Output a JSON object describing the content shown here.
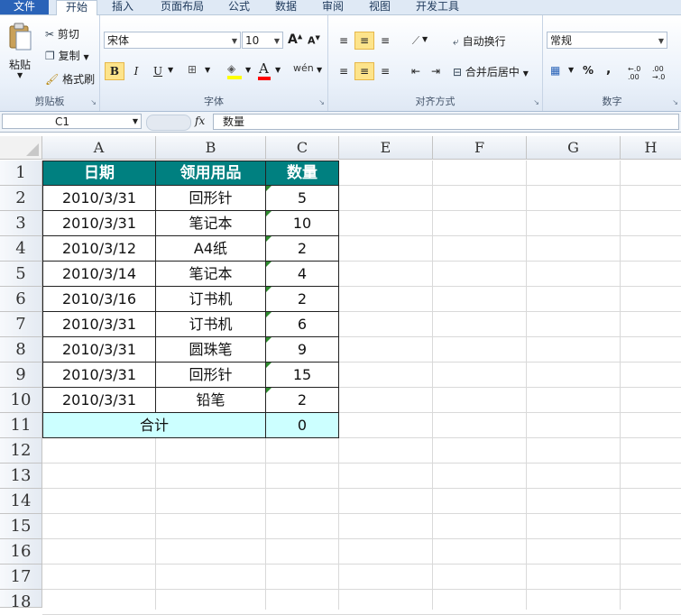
{
  "menu": {
    "tabs": [
      "文件",
      "开始",
      "插入",
      "页面布局",
      "公式",
      "数据",
      "审阅",
      "视图",
      "开发工具"
    ]
  },
  "ribbon": {
    "clipboard": {
      "paste": "粘贴",
      "cut": "剪切",
      "copy": "复制",
      "format_painter": "格式刷",
      "label": "剪贴板"
    },
    "font": {
      "name": "宋体",
      "size": "10",
      "bold": "B",
      "italic": "I",
      "underline": "U",
      "label": "字体",
      "wen": "wén"
    },
    "alignment": {
      "wrap": "自动换行",
      "merge": "合并后居中",
      "label": "对齐方式"
    },
    "number": {
      "format": "常规",
      "percent": "%",
      "comma": ",",
      "inc": "←.0 .00",
      "dec": ".00 →.0",
      "label": "数字"
    }
  },
  "formula_bar": {
    "name_box": "C1",
    "fx": "fx",
    "content": "数量"
  },
  "sheet": {
    "columns": [
      "A",
      "B",
      "C",
      "E",
      "F",
      "G",
      "H"
    ],
    "rows": [
      "1",
      "2",
      "3",
      "4",
      "5",
      "6",
      "7",
      "8",
      "9",
      "10",
      "11",
      "12",
      "13",
      "14",
      "15",
      "16",
      "17",
      "18"
    ],
    "headers": [
      "日期",
      "领用用品",
      "数量"
    ],
    "data": [
      [
        "2010/3/31",
        "回形针",
        "5"
      ],
      [
        "2010/3/31",
        "笔记本",
        "10"
      ],
      [
        "2010/3/12",
        "A4纸",
        "2"
      ],
      [
        "2010/3/14",
        "笔记本",
        "4"
      ],
      [
        "2010/3/16",
        "订书机",
        "2"
      ],
      [
        "2010/3/31",
        "订书机",
        "6"
      ],
      [
        "2010/3/31",
        "圆珠笔",
        "9"
      ],
      [
        "2010/3/31",
        "回形针",
        "15"
      ],
      [
        "2010/3/31",
        "铅笔",
        "2"
      ]
    ],
    "total_label": "合计",
    "total_value": "0"
  },
  "colors": {
    "header_fill": "#008080",
    "total_fill": "#ccffff",
    "error_marker": "#2e8b2e",
    "file_tab": "#2a63b8"
  }
}
